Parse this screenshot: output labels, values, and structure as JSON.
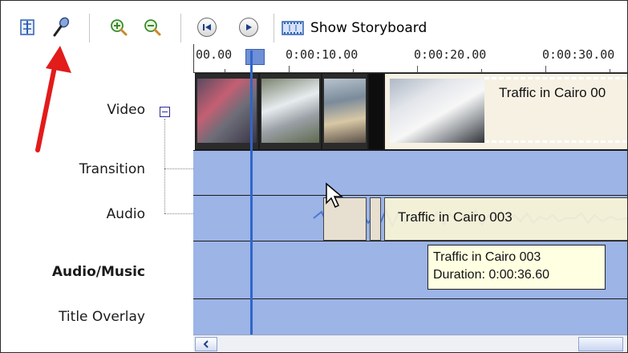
{
  "toolbar": {
    "storyboard_label": "Show Storyboard"
  },
  "timeline": {
    "ruler_labels": [
      "00.00",
      "0:00:10.00",
      "0:00:20.00",
      "0:00:30.00"
    ]
  },
  "tracks": {
    "video": "Video",
    "transition": "Transition",
    "audio": "Audio",
    "audio_music": "Audio/Music",
    "title_overlay": "Title Overlay"
  },
  "clips": {
    "video_title": "Traffic in Cairo 00",
    "audio_title": "Traffic in Cairo 003"
  },
  "tooltip": {
    "line1": "Traffic in Cairo 003",
    "line2": "Duration:  0:00:36.60"
  },
  "colors": {
    "track_bg": "#9cb4e6",
    "playhead": "#2f66c9",
    "arrow": "#e21b1b",
    "tooltip_bg": "#ffffe1"
  }
}
